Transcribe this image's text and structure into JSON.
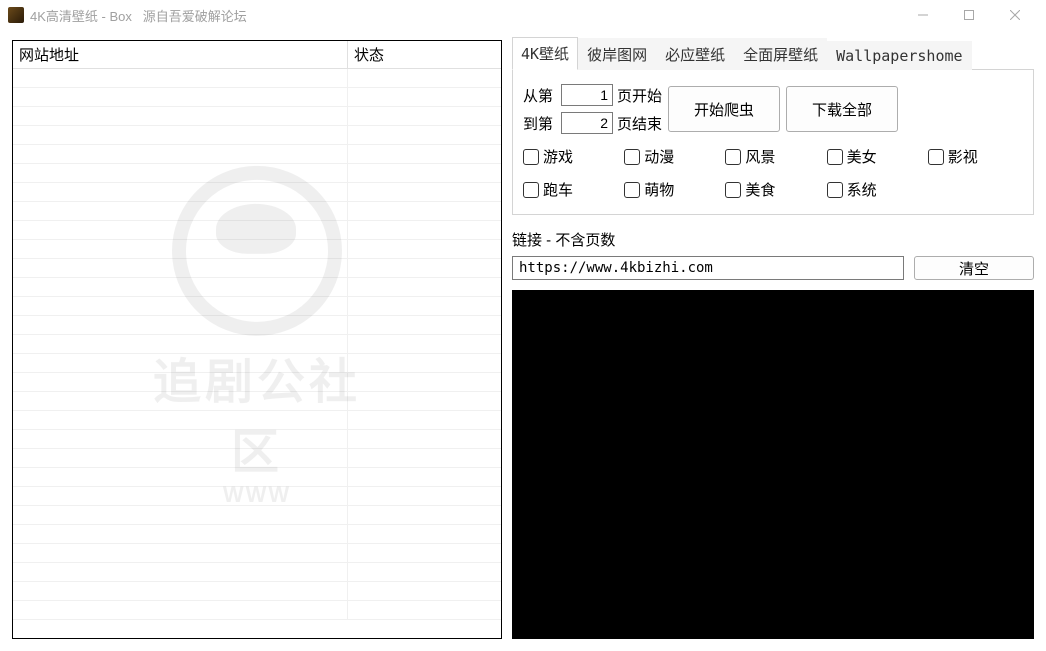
{
  "window": {
    "title": "4K高清壁纸 - Box   源自吾爱破解论坛"
  },
  "grid": {
    "columns": [
      "网站地址",
      "状态"
    ]
  },
  "watermark": {
    "text": "追剧公社区",
    "sub": "WWW"
  },
  "tabs": [
    {
      "label": "4K壁纸",
      "active": true
    },
    {
      "label": "彼岸图网",
      "active": false
    },
    {
      "label": "必应壁纸",
      "active": false
    },
    {
      "label": "全面屏壁纸",
      "active": false
    },
    {
      "label": "Wallpapershome",
      "active": false
    }
  ],
  "range": {
    "from_label": "从第",
    "from_value": "1",
    "from_suffix": "页开始",
    "to_label": "到第",
    "to_value": "2",
    "to_suffix": "页结束"
  },
  "buttons": {
    "start_crawl": "开始爬虫",
    "download_all": "下载全部",
    "clear": "清空"
  },
  "categories": {
    "row1": [
      "游戏",
      "动漫",
      "风景",
      "美女",
      "影视"
    ],
    "row2": [
      "跑车",
      "萌物",
      "美食",
      "系统"
    ]
  },
  "link": {
    "label": "链接 - 不含页数",
    "url": "https://www.4kbizhi.com"
  }
}
